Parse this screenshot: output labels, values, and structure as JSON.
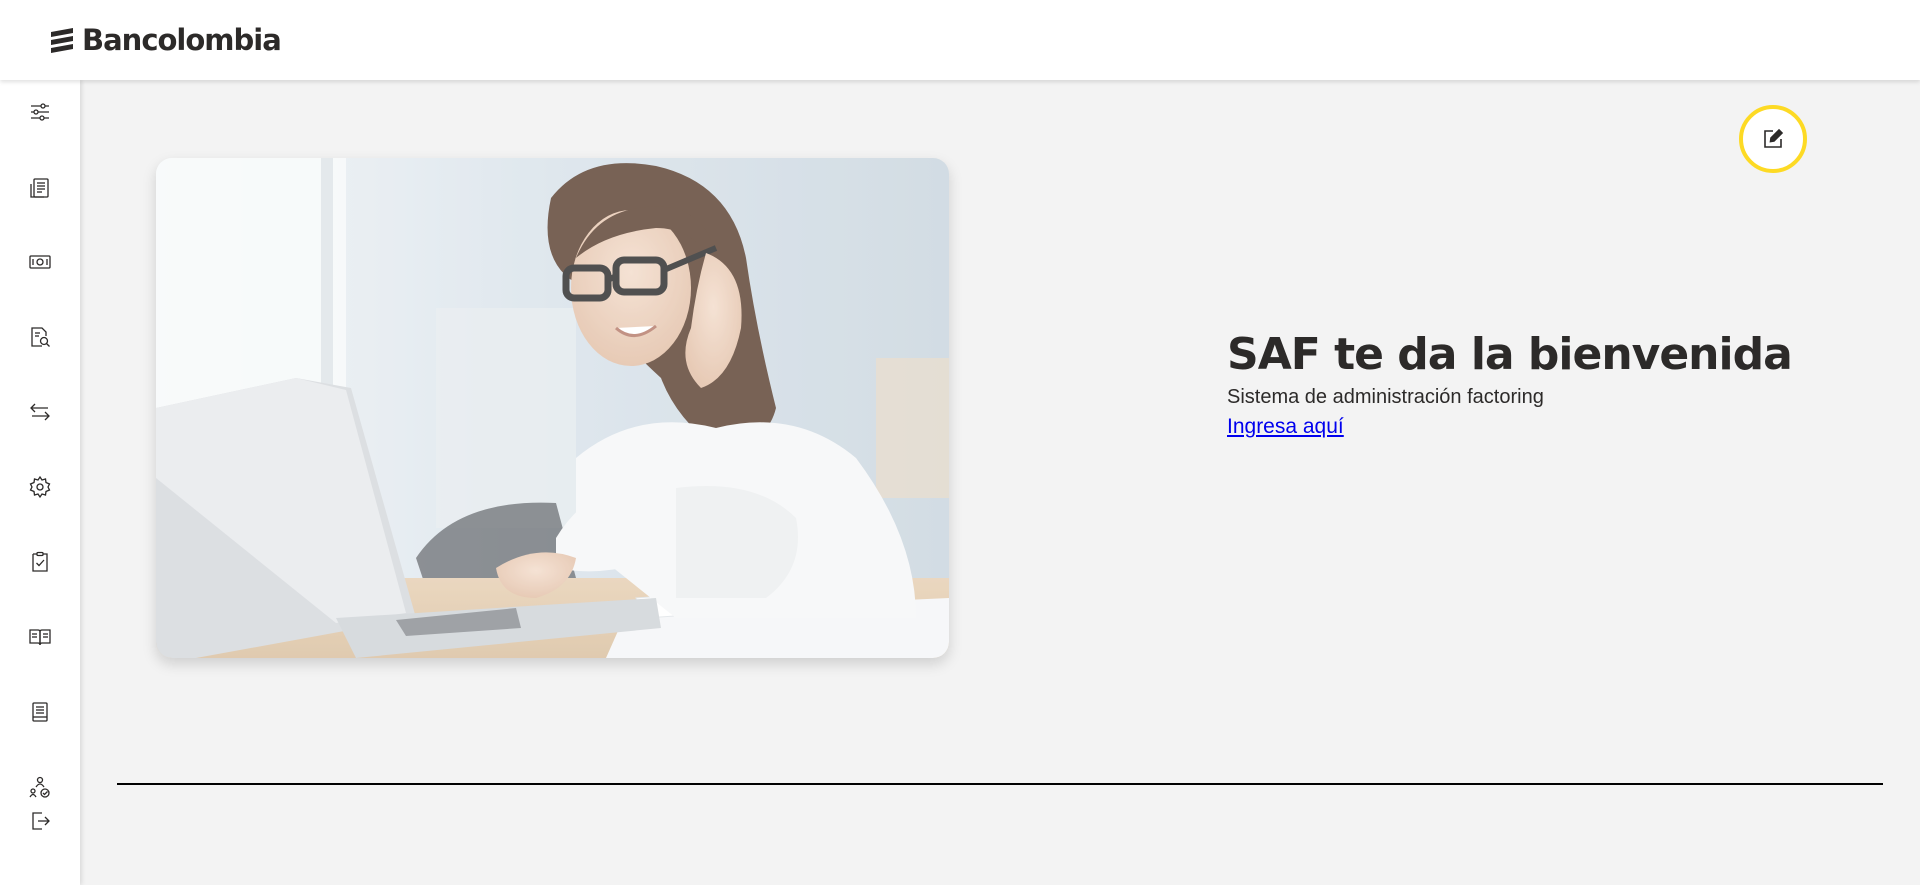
{
  "header": {
    "brand_name": "Bancolombia",
    "brand_logo_icon": "bancolombia-logo-icon"
  },
  "sidebar": {
    "items": [
      {
        "name": "sliders-icon",
        "title": "Ajustes"
      },
      {
        "name": "documents-icon",
        "title": "Documentos"
      },
      {
        "name": "money-icon",
        "title": "Pagos"
      },
      {
        "name": "document-search-icon",
        "title": "Consultas"
      },
      {
        "name": "transfer-arrows-icon",
        "title": "Transferencias"
      },
      {
        "name": "gear-icon",
        "title": "Configuración"
      },
      {
        "name": "document-check-icon",
        "title": "Aprobaciones"
      },
      {
        "name": "book-icon",
        "title": "Manual"
      },
      {
        "name": "notebook-icon",
        "title": "Reportes"
      },
      {
        "name": "users-check-icon",
        "title": "Usuarios"
      },
      {
        "name": "logout-icon",
        "title": "Salir"
      }
    ]
  },
  "main": {
    "hero_image": "woman-working-on-laptop-photo",
    "edit_button_icon": "edit-icon",
    "welcome_title": "SAF te da la bienvenida",
    "welcome_subtitle": "Sistema de administración factoring",
    "welcome_link": "Ingresa aquí"
  },
  "colors": {
    "accent_yellow": "#fdda24",
    "text_dark": "#2c2a29",
    "link_blue": "#0000ee",
    "background": "#f3f3f3"
  }
}
